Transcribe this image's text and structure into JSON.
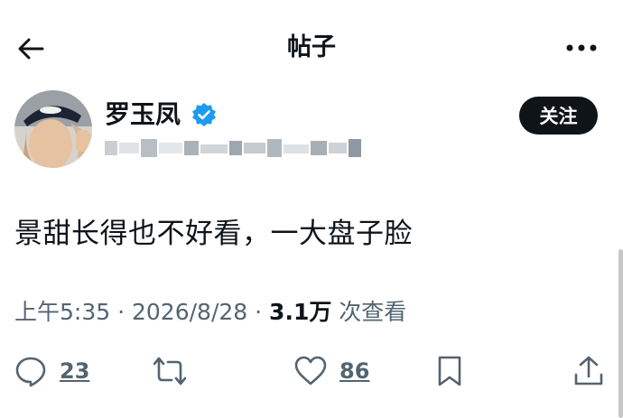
{
  "header": {
    "title": "帖子",
    "back_icon": "arrow-left-icon",
    "more_icon": "more-horizontal-icon"
  },
  "post": {
    "author_name": "罗玉凤",
    "verified_icon": "verified-badge-icon",
    "verified_color": "#1d9bf0",
    "handle_obscured": true,
    "follow_label": "关注",
    "text": "景甜长得也不好看，一大盘子脸",
    "time": "上午5:35",
    "separator": "·",
    "date": "2026/8/28",
    "views_count": "3.1万",
    "views_label": "次查看"
  },
  "actions": {
    "reply": {
      "icon": "reply-icon",
      "count": "23"
    },
    "repost": {
      "icon": "repost-icon"
    },
    "like": {
      "icon": "heart-icon",
      "count": "86"
    },
    "bookmark": {
      "icon": "bookmark-icon"
    },
    "share": {
      "icon": "share-icon"
    }
  }
}
